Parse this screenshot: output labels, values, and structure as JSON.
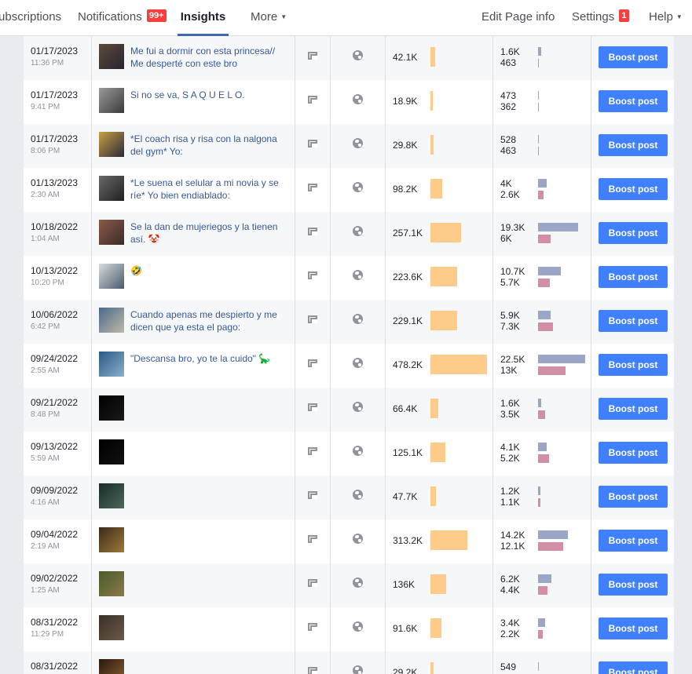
{
  "nav": {
    "subscriptions": "Subscriptions",
    "notifications": "Notifications",
    "notifications_badge": "99+",
    "insights": "Insights",
    "more": "More",
    "edit_page_info": "Edit Page info",
    "settings": "Settings",
    "settings_badge": "1",
    "help": "Help",
    "accent_color": "#4267b2"
  },
  "boost_label": "Boost post",
  "posts": [
    {
      "date": "01/17/2023",
      "time": "11:36 PM",
      "title": "Me fui a dormir con esta princesa// Me desperté con este bro",
      "reach": "42.1K",
      "reach_value": 42100,
      "stat1": "1.6K",
      "stat1_value": 1600,
      "stat2": "463",
      "stat2_value": 463,
      "thumb_colors": [
        "#5a4a3a",
        "#2a2430"
      ]
    },
    {
      "date": "01/17/2023",
      "time": "9:41 PM",
      "title": "Si no se va, S A Q U E L O.",
      "reach": "18.9K",
      "reach_value": 18900,
      "stat1": "473",
      "stat1_value": 473,
      "stat2": "362",
      "stat2_value": 362,
      "thumb_colors": [
        "#9a9a9a",
        "#3a3a3a"
      ]
    },
    {
      "date": "01/17/2023",
      "time": "8:06 PM",
      "title": "*El coach risa y risa con la nalgona del gym* Yo:",
      "reach": "29.8K",
      "reach_value": 29800,
      "stat1": "528",
      "stat1_value": 528,
      "stat2": "463",
      "stat2_value": 463,
      "thumb_colors": [
        "#c8a040",
        "#2b2a3a"
      ]
    },
    {
      "date": "01/13/2023",
      "time": "2:30 AM",
      "title": "*Le suena el selular a mi novia y se ríe* Yo bien endiablado:",
      "reach": "98.2K",
      "reach_value": 98200,
      "stat1": "4K",
      "stat1_value": 4000,
      "stat2": "2.6K",
      "stat2_value": 2600,
      "thumb_colors": [
        "#6a6a6a",
        "#1e1e1e"
      ]
    },
    {
      "date": "10/18/2022",
      "time": "1:04 AM",
      "title": "Se la dan de mujeriegos y la tienen así. 🤡",
      "reach": "257.1K",
      "reach_value": 257100,
      "stat1": "19.3K",
      "stat1_value": 19300,
      "stat2": "6K",
      "stat2_value": 6000,
      "thumb_colors": [
        "#8a5a4a",
        "#3a2a2a"
      ]
    },
    {
      "date": "10/13/2022",
      "time": "10:20 PM",
      "title": "🤣",
      "reach": "223.6K",
      "reach_value": 223600,
      "stat1": "10.7K",
      "stat1_value": 10700,
      "stat2": "5.7K",
      "stat2_value": 5700,
      "thumb_colors": [
        "#d8dce0",
        "#4a5a6a"
      ]
    },
    {
      "date": "10/06/2022",
      "time": "6:42 PM",
      "title": "Cuando apenas me despierto y me dicen que ya esta el pago:",
      "reach": "229.1K",
      "reach_value": 229100,
      "stat1": "5.9K",
      "stat1_value": 5900,
      "stat2": "7.3K",
      "stat2_value": 7300,
      "thumb_colors": [
        "#4a6a8a",
        "#c0b8a8"
      ]
    },
    {
      "date": "09/24/2022",
      "time": "2:55 AM",
      "title": "\"Descansa bro, yo te la cuido\" 🦕",
      "reach": "478.2K",
      "reach_value": 478200,
      "stat1": "22.5K",
      "stat1_value": 22500,
      "stat2": "13K",
      "stat2_value": 13000,
      "thumb_colors": [
        "#2a5a8a",
        "#8ab0c8"
      ]
    },
    {
      "date": "09/21/2022",
      "time": "8:48 PM",
      "title": "",
      "reach": "66.4K",
      "reach_value": 66400,
      "stat1": "1.6K",
      "stat1_value": 1600,
      "stat2": "3.5K",
      "stat2_value": 3500,
      "thumb_colors": [
        "#000000",
        "#1a1a1a"
      ]
    },
    {
      "date": "09/13/2022",
      "time": "5:59 AM",
      "title": "",
      "reach": "125.1K",
      "reach_value": 125100,
      "stat1": "4.1K",
      "stat1_value": 4100,
      "stat2": "5.2K",
      "stat2_value": 5200,
      "thumb_colors": [
        "#000000",
        "#111111"
      ]
    },
    {
      "date": "09/09/2022",
      "time": "4:16 AM",
      "title": "",
      "reach": "47.7K",
      "reach_value": 47700,
      "stat1": "1.2K",
      "stat1_value": 1200,
      "stat2": "1.1K",
      "stat2_value": 1100,
      "thumb_colors": [
        "#1a2a2a",
        "#4a6a5a"
      ]
    },
    {
      "date": "09/04/2022",
      "time": "2:19 AM",
      "title": "",
      "reach": "313.2K",
      "reach_value": 313200,
      "stat1": "14.2K",
      "stat1_value": 14200,
      "stat2": "12.1K",
      "stat2_value": 12100,
      "thumb_colors": [
        "#3a2a1a",
        "#a07a3a"
      ]
    },
    {
      "date": "09/02/2022",
      "time": "1:25 AM",
      "title": "",
      "reach": "136K",
      "reach_value": 136000,
      "stat1": "6.2K",
      "stat1_value": 6200,
      "stat2": "4.4K",
      "stat2_value": 4400,
      "thumb_colors": [
        "#4a5a2a",
        "#8a7a4a"
      ]
    },
    {
      "date": "08/31/2022",
      "time": "11:29 PM",
      "title": "",
      "reach": "91.6K",
      "reach_value": 91600,
      "stat1": "3.4K",
      "stat1_value": 3400,
      "stat2": "2.2K",
      "stat2_value": 2200,
      "thumb_colors": [
        "#3a3028",
        "#6a5a48"
      ]
    },
    {
      "date": "08/31/2022",
      "time": "",
      "title": "",
      "reach": "29.2K",
      "reach_value": 29200,
      "stat1": "549",
      "stat1_value": 549,
      "stat2": "",
      "stat2_value": 0,
      "thumb_colors": [
        "#2a1a10",
        "#8a6030"
      ]
    }
  ]
}
